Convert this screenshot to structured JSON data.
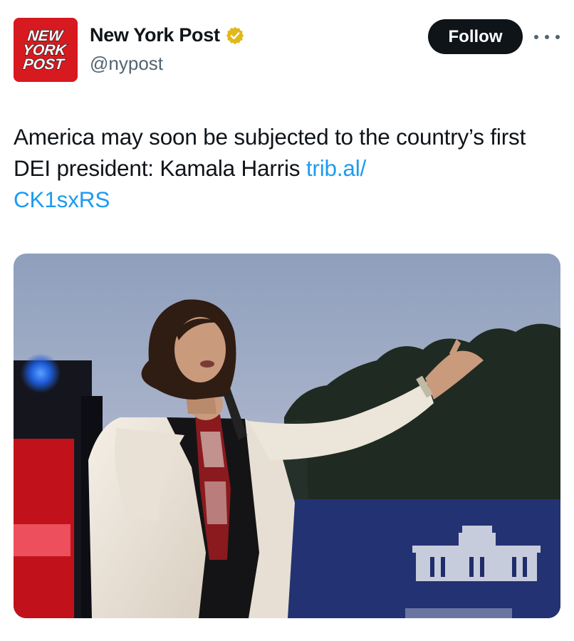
{
  "account": {
    "display_name": "New York Post",
    "handle": "@nypost",
    "avatar_text": [
      "NEW",
      "YORK",
      "POST"
    ],
    "verified_icon": "gold-verified-badge-icon",
    "brand_color": "#d71920",
    "verified_color": "#e2b719"
  },
  "actions": {
    "follow_label": "Follow",
    "more_icon": "more-dots-icon"
  },
  "tweet": {
    "text": "America may soon be subjected to the country’s first DEI president: Kamala Harris ",
    "link_line1": "trib.al/",
    "link_line2": "CK1sxRS",
    "link_color": "#1d9bf0"
  },
  "media": {
    "image_icon": "photo-woman-speaking-at-microphone-outdoors"
  }
}
